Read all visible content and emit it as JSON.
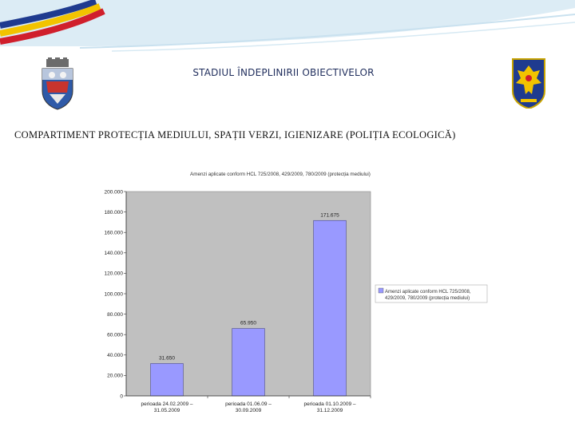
{
  "header": {
    "title": "STADIUL ÎNDEPLINIRII OBIECTIVELOR"
  },
  "section": {
    "heading": "COMPARTIMENT PROTECȚIA MEDIULUI, SPAȚII VERZI, IGIENIZARE   (POLIȚIA ECOLOGICĂ)"
  },
  "decor": {
    "banner_colors": [
      "#1f3b8f",
      "#f2c300",
      "#d01f2c",
      "#dcecf5"
    ],
    "left_crest_icon": "city-coat-of-arms-icon",
    "right_crest_icon": "police-eagle-crest-icon"
  },
  "chart_data": {
    "type": "bar",
    "title": "Amenzi aplicate conform HCL 725/2008, 429/2009, 780/2009 (protecția mediului)",
    "categories": [
      [
        "perioada 24.02.2009 –",
        "31.05.2009"
      ],
      [
        "perioada 01.06.09 –",
        "30.09.2009"
      ],
      [
        "perioada 01.10.2009 –",
        "31.12.2009"
      ]
    ],
    "series": [
      {
        "name": "Amenzi aplicate conform HCL 725/2008, 429/2009, 780/2009 (protecția mediului)",
        "values": [
          31650,
          65950,
          171675
        ],
        "labels": [
          "31.650",
          "65.950",
          "171.675"
        ],
        "color": "#9999ff"
      }
    ],
    "y_ticks": [
      "0",
      "20.000",
      "40.000",
      "60.000",
      "80.000",
      "100.000",
      "120.000",
      "140.000",
      "160.000",
      "180.000",
      "200.000"
    ],
    "ylim": [
      0,
      200000
    ],
    "plot_background": "#c0c0c0",
    "legend_position": "right",
    "grid": false
  }
}
